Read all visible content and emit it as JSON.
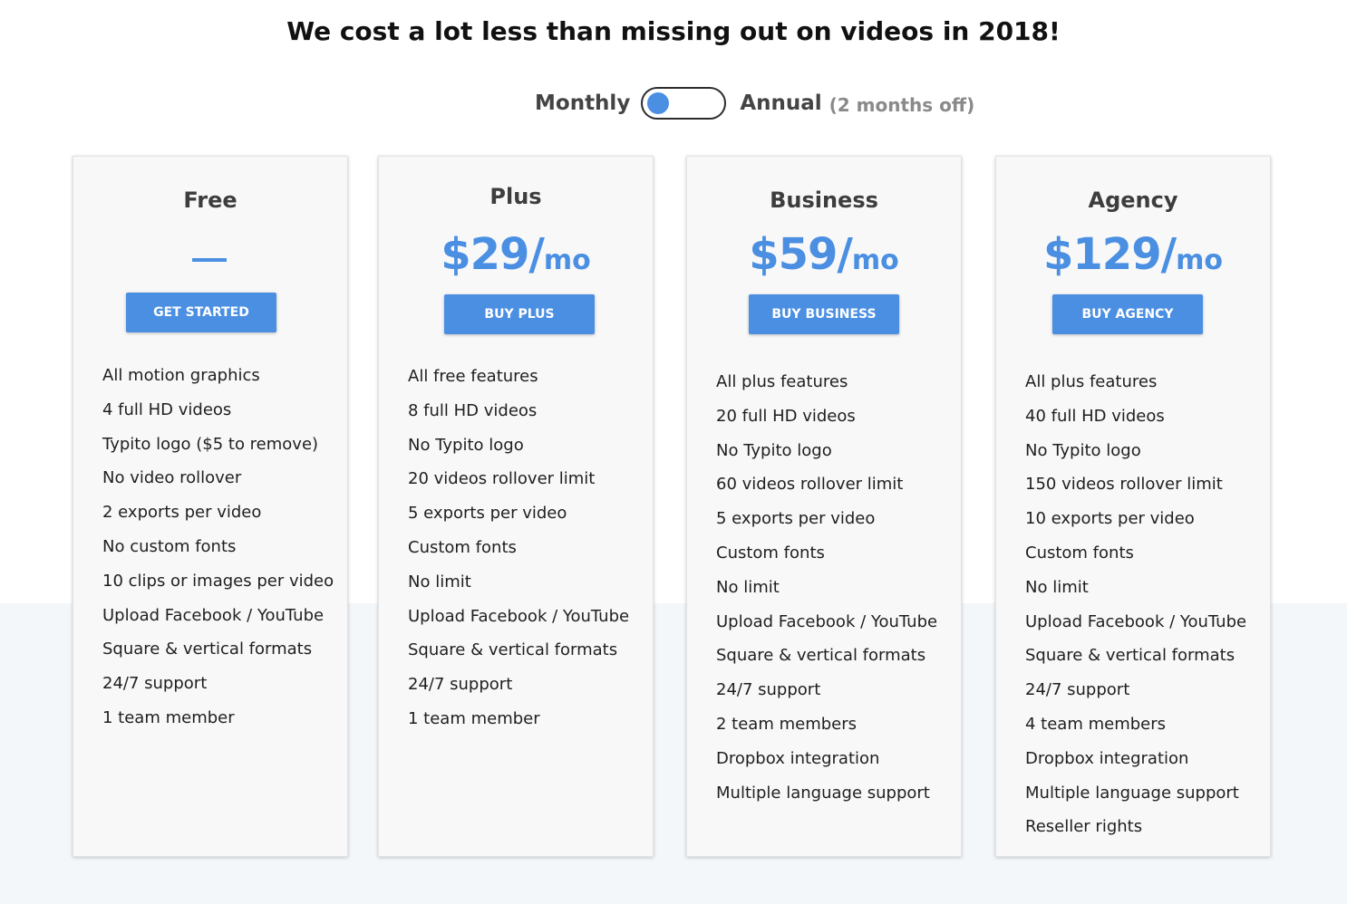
{
  "headline": "We cost a lot less than missing out on videos in 2018!",
  "billing": {
    "monthly_label": "Monthly",
    "annual_label": "Annual",
    "annual_note": "(2 months off)",
    "selected": "Monthly"
  },
  "colors": {
    "accent": "#4a8fe2",
    "band": "#f4f7fa"
  },
  "plans": [
    {
      "name": "Free",
      "price": "",
      "price_unit": "",
      "price_placeholder": "—",
      "cta": "GET STARTED",
      "features": [
        "All motion graphics",
        "4 full HD videos",
        "Typito logo ($5 to remove)",
        "No video rollover",
        "2 exports per video",
        "No custom fonts",
        "10 clips or images per video",
        "Upload Facebook / YouTube",
        "Square & vertical formats",
        "24/7 support",
        "1 team member"
      ]
    },
    {
      "name": "Plus",
      "price": "$29/",
      "price_unit": "mo",
      "cta": "BUY PLUS",
      "features": [
        "All free features",
        "8 full HD videos",
        "No Typito logo",
        "20 videos rollover limit",
        "5 exports per video",
        "Custom fonts",
        "No limit",
        "Upload Facebook / YouTube",
        "Square & vertical formats",
        "24/7 support",
        "1 team member"
      ]
    },
    {
      "name": "Business",
      "price": "$59/",
      "price_unit": "mo",
      "cta": "BUY BUSINESS",
      "features": [
        "All plus features",
        "20 full HD videos",
        "No Typito logo",
        "60 videos rollover limit",
        "5 exports per video",
        "Custom fonts",
        "No limit",
        "Upload Facebook / YouTube",
        "Square & vertical formats",
        "24/7 support",
        "2 team members",
        "Dropbox integration",
        "Multiple language support"
      ]
    },
    {
      "name": "Agency",
      "price": "$129/",
      "price_unit": "mo",
      "cta": "BUY AGENCY",
      "features": [
        "All plus features",
        "40 full HD videos",
        "No Typito logo",
        "150 videos rollover limit",
        "10 exports per video",
        "Custom fonts",
        "No limit",
        "Upload Facebook / YouTube",
        "Square & vertical formats",
        "24/7 support",
        "4 team members",
        "Dropbox integration",
        "Multiple language support",
        "Reseller rights"
      ]
    }
  ]
}
